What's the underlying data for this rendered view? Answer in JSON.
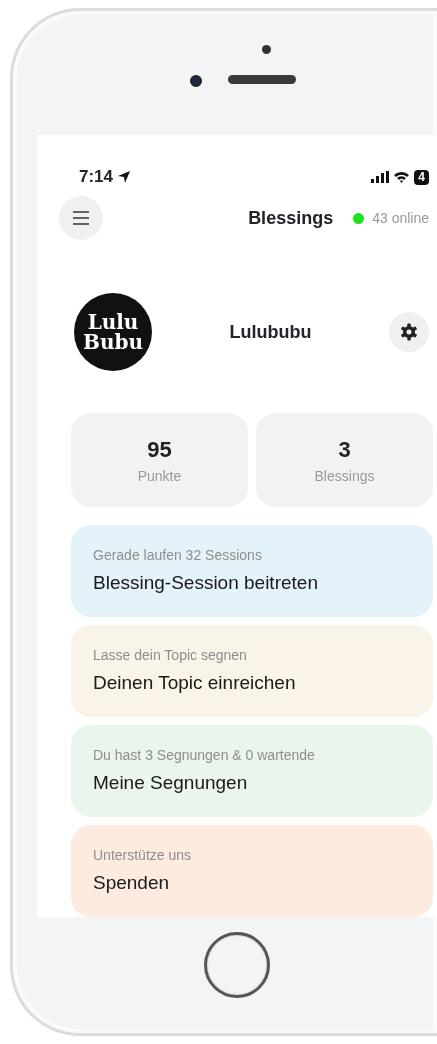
{
  "status_bar": {
    "time": "7:14",
    "battery": "4"
  },
  "header": {
    "title": "Blessings",
    "online": "43 online"
  },
  "profile": {
    "logo_lines": [
      "Lulu",
      "Bubu"
    ],
    "name": "Lulububu"
  },
  "stats": [
    {
      "value": "95",
      "label": "Punkte"
    },
    {
      "value": "3",
      "label": "Blessings"
    }
  ],
  "actions": [
    {
      "subtitle": "Gerade laufen 32 Sessions",
      "title": "Blessing-Session beitreten",
      "color": "#e4f2f9"
    },
    {
      "subtitle": "Lasse dein Topic segnen",
      "title": "Deinen Topic einreichen",
      "color": "#faf3e8"
    },
    {
      "subtitle": "Du hast 3 Segnungen & 0 wartende",
      "title": "Meine Segnungen",
      "color": "#eaf5eb"
    },
    {
      "subtitle": "Unterstütze uns",
      "title": "Spenden",
      "color": "#fdebe0"
    }
  ]
}
